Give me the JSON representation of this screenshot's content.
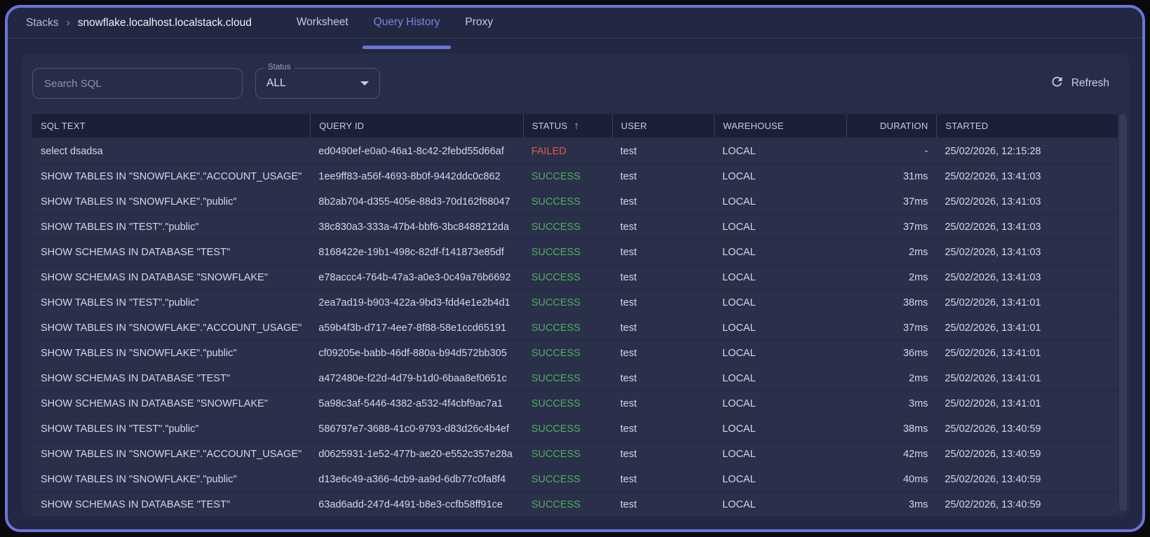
{
  "topbar": {
    "breadcrumb": {
      "root": "Stacks",
      "separator": "›",
      "current": "snowflake.localhost.localstack.cloud"
    },
    "tabs": [
      {
        "label": "Worksheet",
        "active": false
      },
      {
        "label": "Query History",
        "active": true
      },
      {
        "label": "Proxy",
        "active": false
      }
    ]
  },
  "toolbar": {
    "search_placeholder": "Search SQL",
    "status_filter": {
      "label": "Status",
      "value": "ALL"
    },
    "refresh_label": "Refresh"
  },
  "table": {
    "columns": [
      "SQL TEXT",
      "QUERY ID",
      "STATUS",
      "USER",
      "WAREHOUSE",
      "DURATION",
      "STARTED"
    ],
    "sort": {
      "column": "STATUS",
      "direction": "asc",
      "arrow": "↑"
    },
    "rows": [
      {
        "sql": "select dsadsa",
        "query_id": "ed0490ef-e0a0-46a1-8c42-2febd55d66af",
        "status": "FAILED",
        "user": "test",
        "warehouse": "LOCAL",
        "duration": "-",
        "started": "25/02/2026, 12:15:28"
      },
      {
        "sql": "SHOW TABLES IN \"SNOWFLAKE\".\"ACCOUNT_USAGE\"",
        "query_id": "1ee9ff83-a56f-4693-8b0f-9442ddc0c862",
        "status": "SUCCESS",
        "user": "test",
        "warehouse": "LOCAL",
        "duration": "31ms",
        "started": "25/02/2026, 13:41:03"
      },
      {
        "sql": "SHOW TABLES IN \"SNOWFLAKE\".\"public\"",
        "query_id": "8b2ab704-d355-405e-88d3-70d162f68047",
        "status": "SUCCESS",
        "user": "test",
        "warehouse": "LOCAL",
        "duration": "37ms",
        "started": "25/02/2026, 13:41:03"
      },
      {
        "sql": "SHOW TABLES IN \"TEST\".\"public\"",
        "query_id": "38c830a3-333a-47b4-bbf6-3bc8488212da",
        "status": "SUCCESS",
        "user": "test",
        "warehouse": "LOCAL",
        "duration": "37ms",
        "started": "25/02/2026, 13:41:03"
      },
      {
        "sql": "SHOW SCHEMAS IN DATABASE \"TEST\"",
        "query_id": "8168422e-19b1-498c-82df-f141873e85df",
        "status": "SUCCESS",
        "user": "test",
        "warehouse": "LOCAL",
        "duration": "2ms",
        "started": "25/02/2026, 13:41:03"
      },
      {
        "sql": "SHOW SCHEMAS IN DATABASE \"SNOWFLAKE\"",
        "query_id": "e78accc4-764b-47a3-a0e3-0c49a76b6692",
        "status": "SUCCESS",
        "user": "test",
        "warehouse": "LOCAL",
        "duration": "2ms",
        "started": "25/02/2026, 13:41:03"
      },
      {
        "sql": "SHOW TABLES IN \"TEST\".\"public\"",
        "query_id": "2ea7ad19-b903-422a-9bd3-fdd4e1e2b4d1",
        "status": "SUCCESS",
        "user": "test",
        "warehouse": "LOCAL",
        "duration": "38ms",
        "started": "25/02/2026, 13:41:01"
      },
      {
        "sql": "SHOW TABLES IN \"SNOWFLAKE\".\"ACCOUNT_USAGE\"",
        "query_id": "a59b4f3b-d717-4ee7-8f88-58e1ccd65191",
        "status": "SUCCESS",
        "user": "test",
        "warehouse": "LOCAL",
        "duration": "37ms",
        "started": "25/02/2026, 13:41:01"
      },
      {
        "sql": "SHOW TABLES IN \"SNOWFLAKE\".\"public\"",
        "query_id": "cf09205e-babb-46df-880a-b94d572bb305",
        "status": "SUCCESS",
        "user": "test",
        "warehouse": "LOCAL",
        "duration": "36ms",
        "started": "25/02/2026, 13:41:01"
      },
      {
        "sql": "SHOW SCHEMAS IN DATABASE \"TEST\"",
        "query_id": "a472480e-f22d-4d79-b1d0-6baa8ef0651c",
        "status": "SUCCESS",
        "user": "test",
        "warehouse": "LOCAL",
        "duration": "2ms",
        "started": "25/02/2026, 13:41:01"
      },
      {
        "sql": "SHOW SCHEMAS IN DATABASE \"SNOWFLAKE\"",
        "query_id": "5a98c3af-5446-4382-a532-4f4cbf9ac7a1",
        "status": "SUCCESS",
        "user": "test",
        "warehouse": "LOCAL",
        "duration": "3ms",
        "started": "25/02/2026, 13:41:01"
      },
      {
        "sql": "SHOW TABLES IN \"TEST\".\"public\"",
        "query_id": "586797e7-3688-41c0-9793-d83d26c4b4ef",
        "status": "SUCCESS",
        "user": "test",
        "warehouse": "LOCAL",
        "duration": "38ms",
        "started": "25/02/2026, 13:40:59"
      },
      {
        "sql": "SHOW TABLES IN \"SNOWFLAKE\".\"ACCOUNT_USAGE\"",
        "query_id": "d0625931-1e52-477b-ae20-e552c357e28a",
        "status": "SUCCESS",
        "user": "test",
        "warehouse": "LOCAL",
        "duration": "42ms",
        "started": "25/02/2026, 13:40:59"
      },
      {
        "sql": "SHOW TABLES IN \"SNOWFLAKE\".\"public\"",
        "query_id": "d13e6c49-a366-4cb9-aa9d-6db77c0fa8f4",
        "status": "SUCCESS",
        "user": "test",
        "warehouse": "LOCAL",
        "duration": "40ms",
        "started": "25/02/2026, 13:40:59"
      },
      {
        "sql": "SHOW SCHEMAS IN DATABASE \"TEST\"",
        "query_id": "63ad6add-247d-4491-b8e3-ccfb58ff91ce",
        "status": "SUCCESS",
        "user": "test",
        "warehouse": "LOCAL",
        "duration": "3ms",
        "started": "25/02/2026, 13:40:59"
      }
    ]
  },
  "colors": {
    "frame_border": "#6b74da",
    "accent_purple": "#7d85e4",
    "status_success": "#4fae63",
    "status_failed": "#e4574c"
  }
}
